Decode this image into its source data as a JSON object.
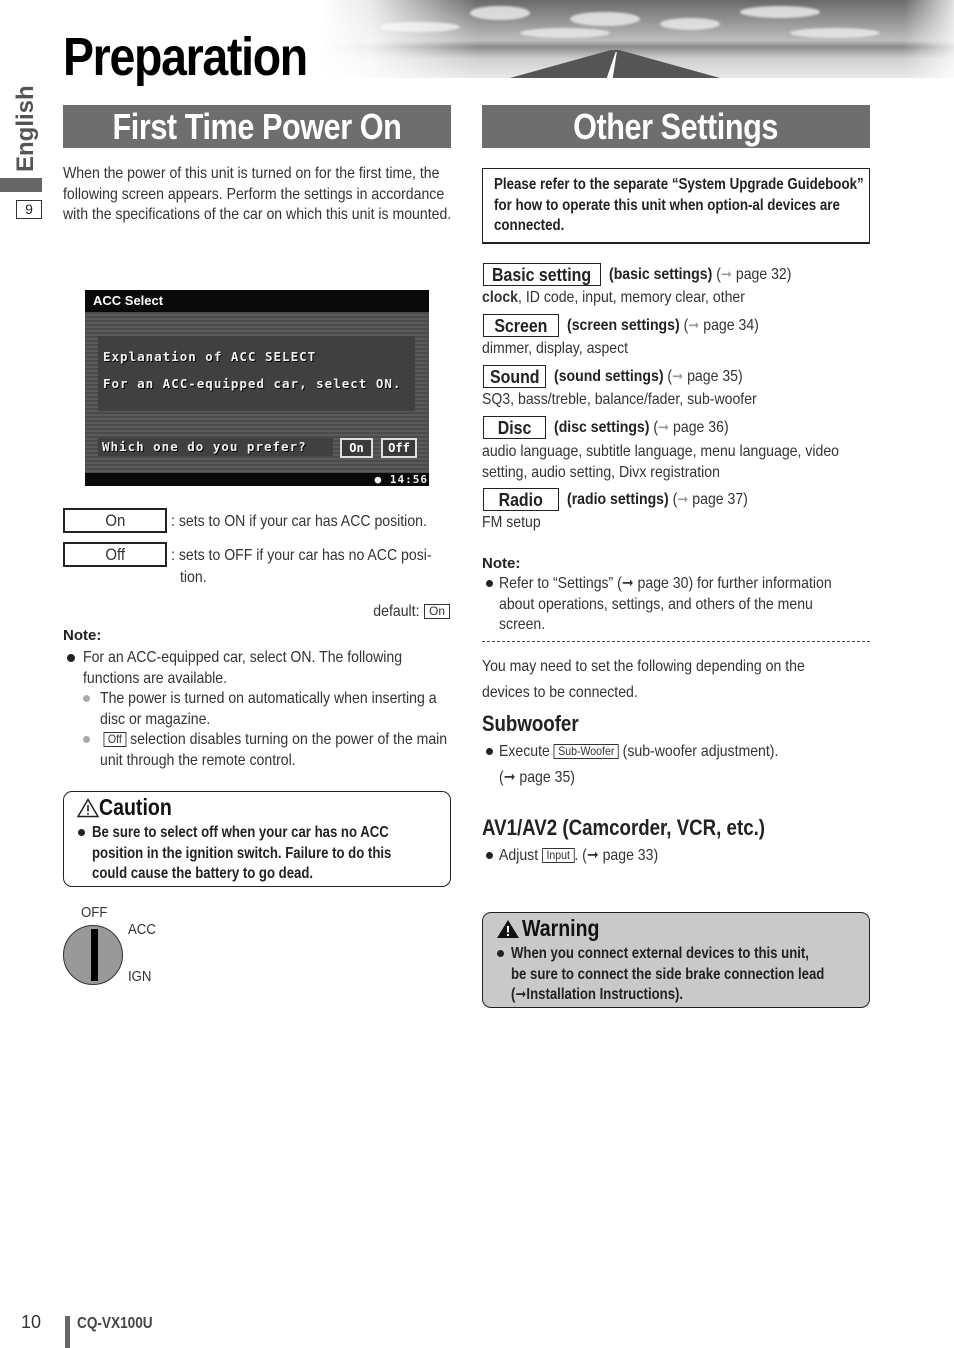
{
  "header": {
    "title": "Preparation",
    "banner_image": "highway-landscape-photo"
  },
  "side_tab": {
    "language": "English",
    "section_number": "9"
  },
  "left": {
    "section_title": "First Time Power On",
    "intro": "When the power of this unit is turned on for the first time, the following screen appears. Perform the settings in accordance with the specifications of the car on which this unit is mounted.",
    "screen": {
      "title": "ACC Select",
      "line1": "Explanation of ACC SELECT",
      "line2": "For an ACC-equipped car, select ON.",
      "question": "Which one do you prefer?",
      "on_button": "On",
      "off_button": "Off",
      "clock": "14:56",
      "clock_icon": "globe-icon"
    },
    "options": [
      {
        "key": "On",
        "desc": ": sets to ON if your car has ACC position."
      },
      {
        "key": "Off",
        "desc": ": sets to OFF if your car has no ACC posi-",
        "desc2": "tion."
      }
    ],
    "default_label": "default:",
    "default_value": "On",
    "note_heading": "Note:",
    "note_bullet": "For an ACC-equipped car, select ON.  The following functions are available.",
    "note_sub1": "The power is turned on automatically when inserting a disc or magazine.",
    "note_sub2_key": "Off",
    "note_sub2": " selection disables turning on the power of the main unit through the remote control.",
    "caution": {
      "title": "Caution",
      "lines": [
        "Be sure to select off when your car has no ACC",
        "position in the ignition switch. Failure to do this",
        "could cause the battery to go dead."
      ]
    },
    "ignition": {
      "off": "OFF",
      "acc": "ACC",
      "ign": "IGN"
    }
  },
  "right": {
    "section_title": "Other Settings",
    "ref_note": "Please refer to the separate “System Upgrade Guidebook” for how to operate this unit when option-al devices are connected.",
    "menus": [
      {
        "key": "Basic setting",
        "desc_bold": "(basic settings)",
        "page": "page 32)",
        "sub_bold": "clock",
        "sub": ", ID code, input, memory clear, other"
      },
      {
        "key": "Screen",
        "desc_bold": "(screen settings)",
        "page": "page 34)",
        "sub": "dimmer, display, aspect"
      },
      {
        "key": "Sound",
        "desc_bold": "(sound settings)",
        "page": "page 35)",
        "sub": "SQ3, bass/treble, balance/fader, sub-woofer"
      },
      {
        "key": "Disc",
        "desc_bold": "(disc settings)",
        "page": "page 36)",
        "sub": "audio language, subtitle language, menu language, video",
        "sub2": "setting, audio setting, Divx registration"
      },
      {
        "key": "Radio",
        "desc_bold": "(radio settings)",
        "page": "page 37)",
        "sub": "FM setup"
      }
    ],
    "note_heading": "Note:",
    "note_lines": [
      "Refer to “Settings” (➞ page 30) for further information",
      "about operations, settings, and others of the menu",
      "screen."
    ],
    "devices_intro_1": "You may need to set the following depending on the",
    "devices_intro_2": "devices to be connected.",
    "subwoofer": {
      "heading": "Subwoofer",
      "pre": "Execute ",
      "key": "Sub-Woofer",
      "post": " (sub-woofer adjustment).",
      "page": "(➞ page 35)"
    },
    "av": {
      "heading": "AV1/AV2 (Camcorder, VCR, etc.)",
      "pre": "Adjust ",
      "key": "Input",
      "post": ". (➞ page 33)"
    },
    "warning": {
      "title": "Warning",
      "lines": [
        "When you connect external devices to this unit,",
        "be sure to connect the side brake connection lead",
        "(➞Installation Instructions)."
      ]
    }
  },
  "footer": {
    "page_number": "10",
    "model": "CQ-VX100U"
  },
  "colors": {
    "section_head_bg": "#6e6e6e",
    "warning_bg": "#c9c9c9",
    "arrow": "#999999"
  }
}
